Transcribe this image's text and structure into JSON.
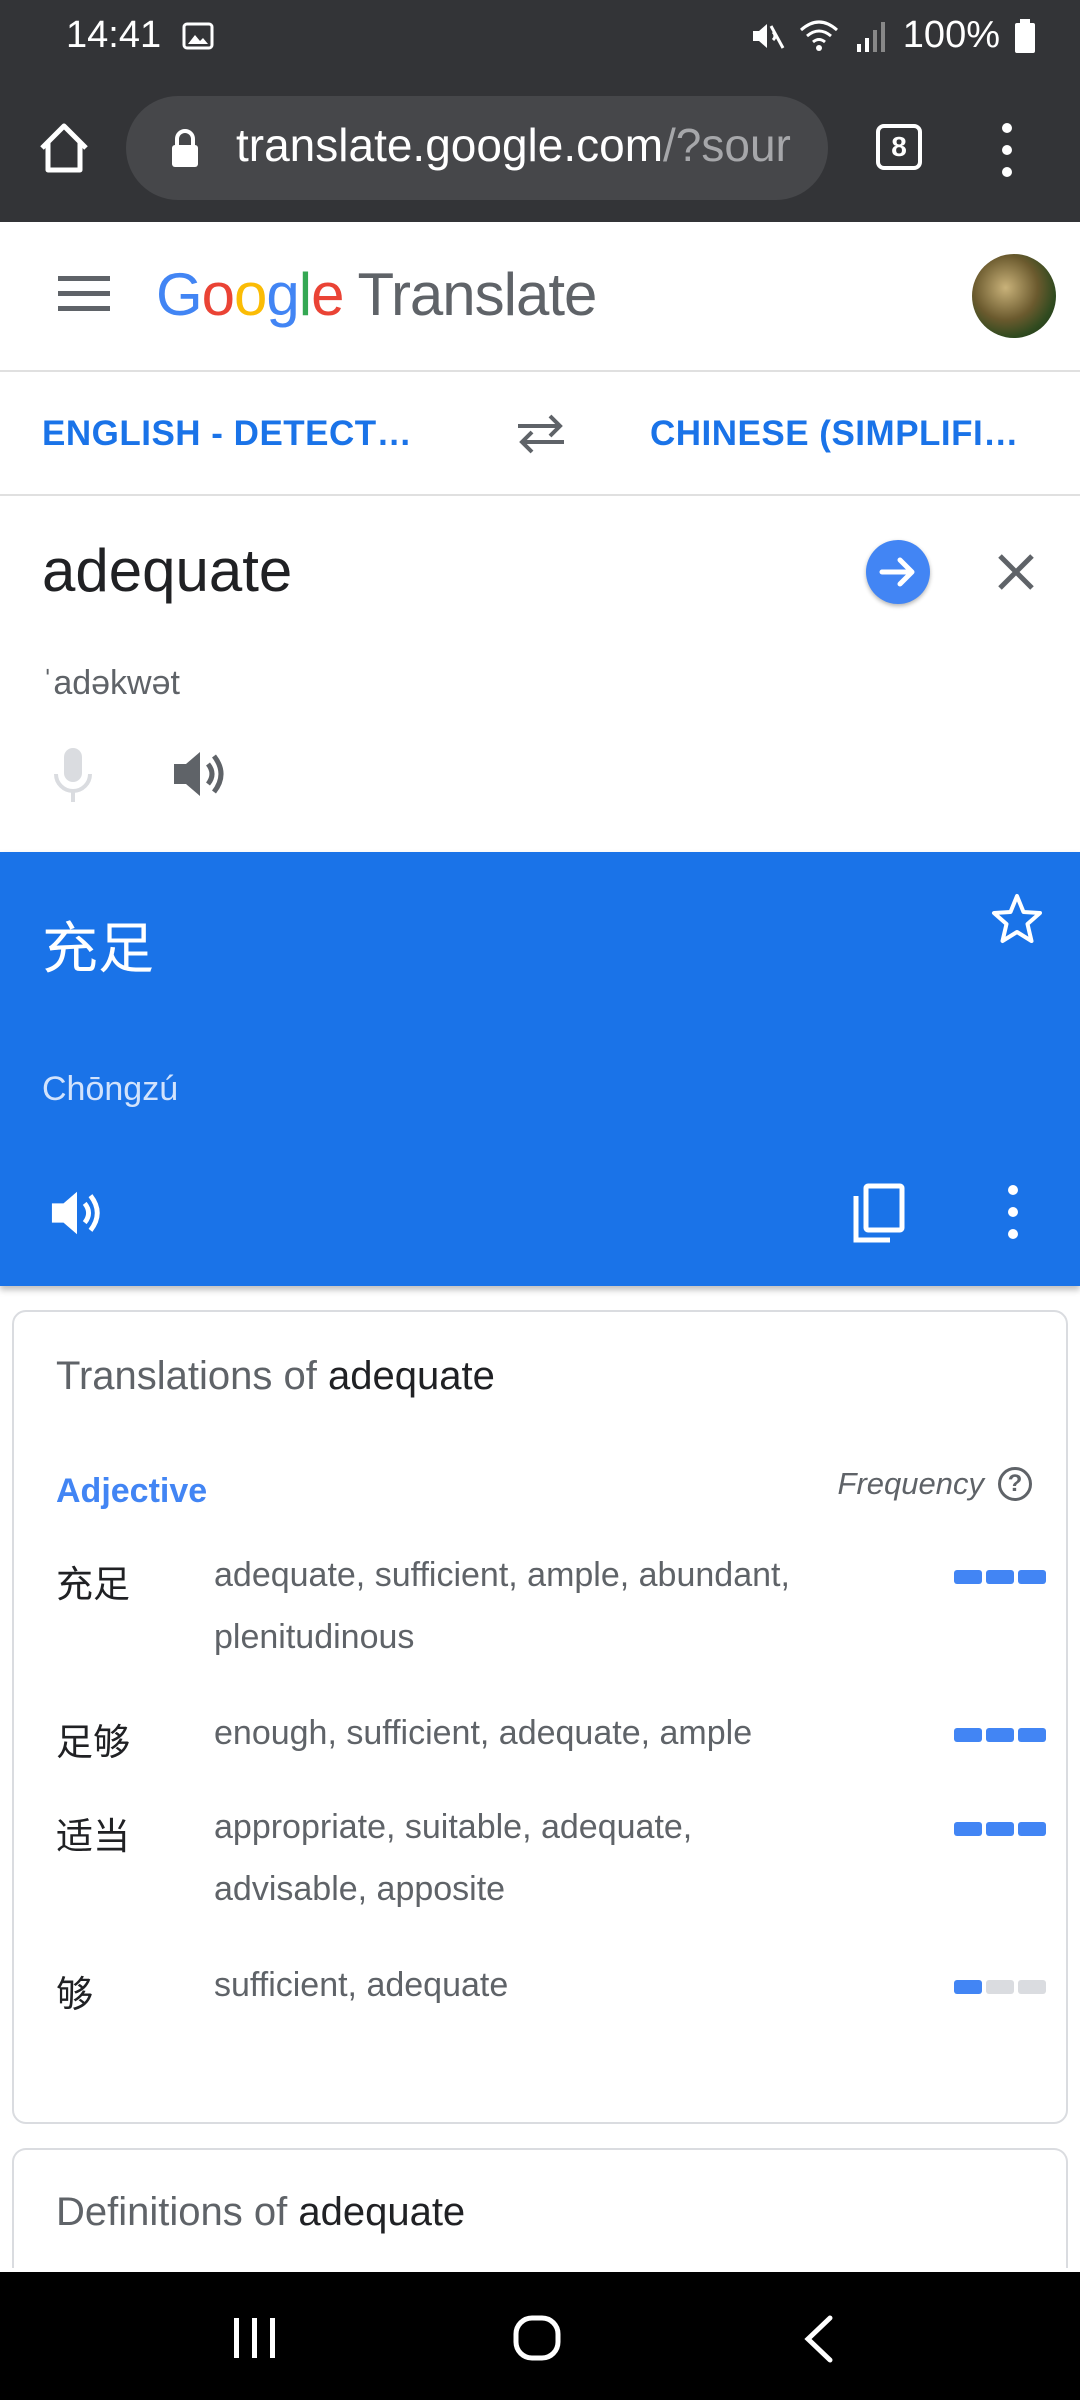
{
  "status_bar": {
    "time": "14:41",
    "battery": "100%"
  },
  "browser": {
    "url_host": "translate.google.com",
    "url_rest": "/?sour",
    "tab_count": "8"
  },
  "header": {
    "logo_letters": [
      "G",
      "o",
      "o",
      "g",
      "l",
      "e"
    ],
    "product": "Translate"
  },
  "languages": {
    "source": "ENGLISH - DETECT…",
    "target": "CHINESE (SIMPLIFI…"
  },
  "input": {
    "text": "adequate",
    "phonetic": "ˈadəkwət"
  },
  "translation": {
    "text": "充足",
    "romanization": "Chōngzú"
  },
  "translations_card": {
    "title_prefix": "Translations of ",
    "title_word": "adequate",
    "part_of_speech": "Adjective",
    "frequency_label": "Frequency",
    "help_glyph": "?",
    "rows": [
      {
        "word": "充足",
        "meanings": "adequate, sufficient, ample, abundant, plenitudinous",
        "frequency": 3
      },
      {
        "word": "足够",
        "meanings": "enough, sufficient, adequate, ample",
        "frequency": 3
      },
      {
        "word": "适当",
        "meanings": "appropriate, suitable, adequate, advisable, apposite",
        "frequency": 3
      },
      {
        "word": "够",
        "meanings": "sufficient, adequate",
        "frequency": 1
      }
    ]
  },
  "definitions_card": {
    "title_prefix": "Definitions of ",
    "title_word": "adequate"
  },
  "colors": {
    "accent": "#1a73e8",
    "bar_on": "#4285f4",
    "bar_off": "#dadce0",
    "chrome": "#333437"
  }
}
